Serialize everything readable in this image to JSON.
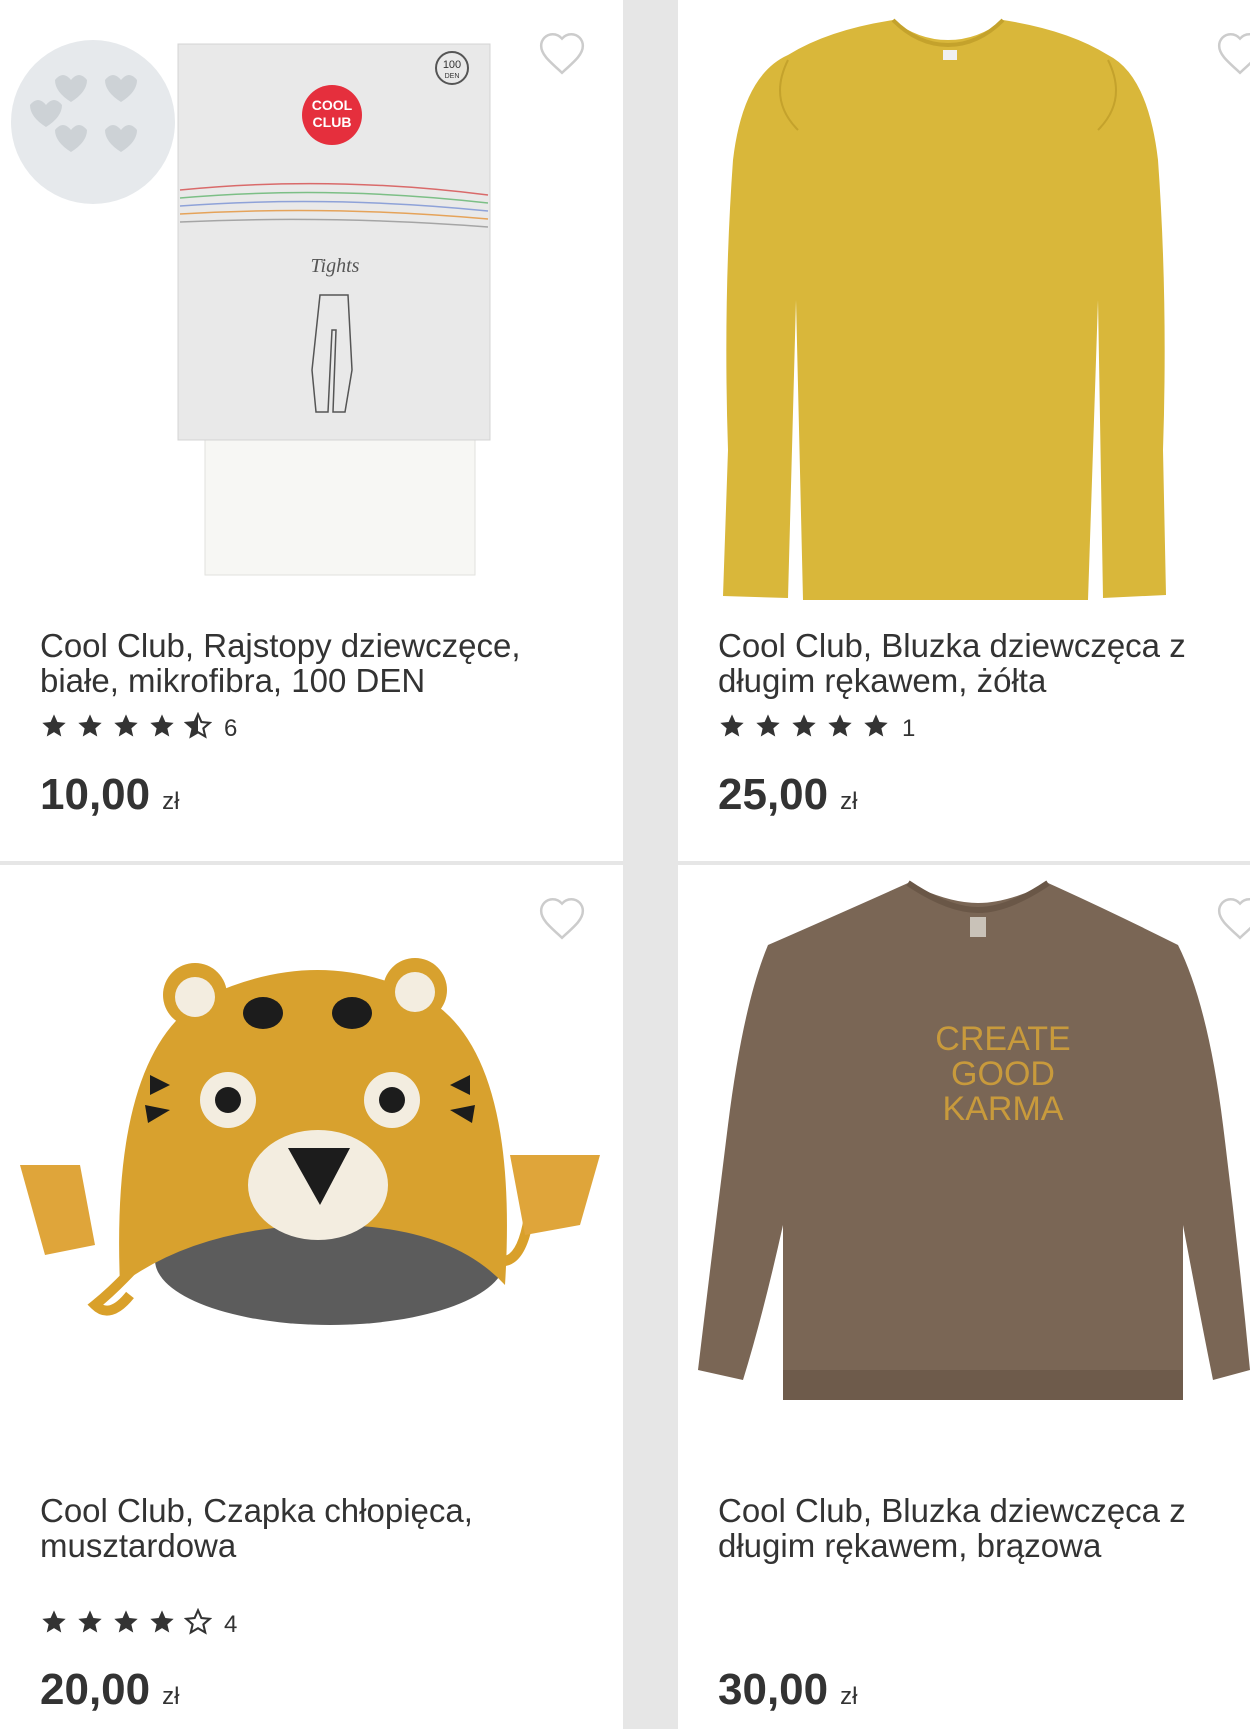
{
  "products": [
    {
      "title": "Cool Club, Rajstopy dziewczęce, białe, mikrofibra, 100 DEN",
      "rating": 4.5,
      "rating_count": "6",
      "price": "10,00",
      "currency": "zł",
      "image_label": "Tights",
      "package_brand": [
        "COOL",
        "CLUB"
      ],
      "package_den": [
        "100",
        "DEN"
      ]
    },
    {
      "title": "Cool Club, Bluzka dziewczęca z długim rękawem, żółta",
      "rating": 5,
      "rating_count": "1",
      "price": "25,00",
      "currency": "zł"
    },
    {
      "title": "Cool Club, Czapka chłopięca, musztardowa",
      "rating": 4,
      "rating_count": "4",
      "price": "20,00",
      "currency": "zł"
    },
    {
      "title": "Cool Club, Bluzka dziewczęca z długim rękawem, brązowa",
      "rating": null,
      "rating_count": null,
      "price": "30,00",
      "currency": "zł",
      "print_lines": [
        "CREATE",
        "GOOD",
        "KARMA"
      ]
    }
  ],
  "icons": {
    "wishlist": "heart-outline-icon",
    "star_full": "star-filled-icon",
    "star_half": "star-half-icon",
    "star_empty": "star-outline-icon"
  },
  "colors": {
    "text": "#333333",
    "star": "#333333",
    "heart": "#cccccc",
    "divider": "#e6e6e6"
  }
}
